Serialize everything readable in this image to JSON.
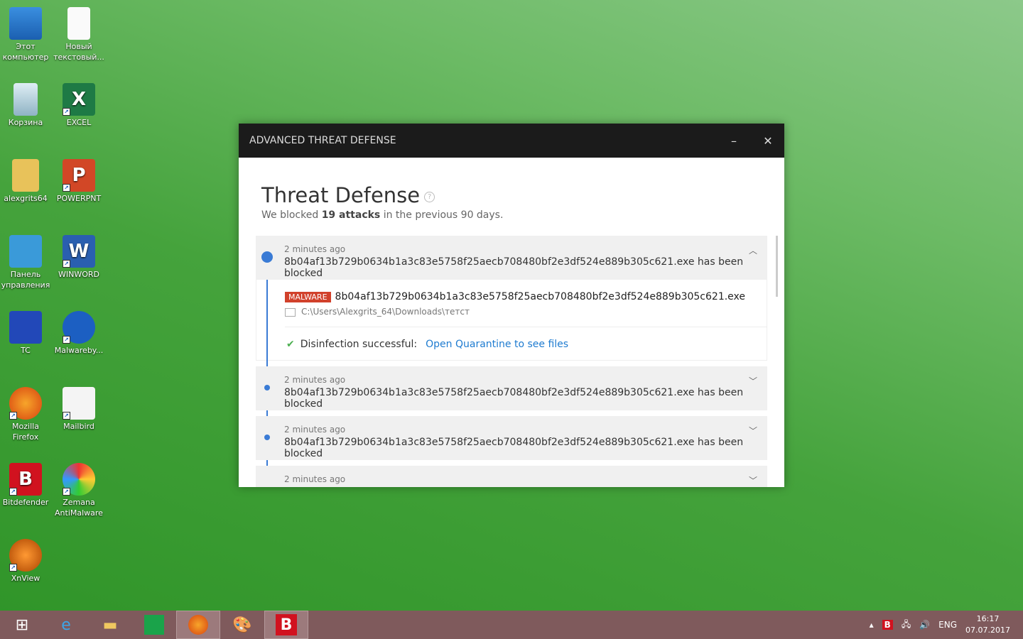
{
  "desktop": {
    "icons": [
      {
        "label": "Этот компьютер",
        "name": "this-pc"
      },
      {
        "label": "Новый текстовый...",
        "name": "new-text-file"
      },
      {
        "label": "Корзина",
        "name": "recycle-bin"
      },
      {
        "label": "EXCEL",
        "name": "excel"
      },
      {
        "label": "alexgrits64",
        "name": "user-folder"
      },
      {
        "label": "POWERPNT",
        "name": "powerpoint"
      },
      {
        "label": "Панель управления",
        "name": "control-panel"
      },
      {
        "label": "WINWORD",
        "name": "word"
      },
      {
        "label": "TC",
        "name": "total-commander"
      },
      {
        "label": "Malwareby...",
        "name": "malwarebytes"
      },
      {
        "label": "Mozilla Firefox",
        "name": "firefox"
      },
      {
        "label": "Mailbird",
        "name": "mailbird"
      },
      {
        "label": "Bitdefender",
        "name": "bitdefender"
      },
      {
        "label": "Zemana AntiMalware",
        "name": "zemana"
      },
      {
        "label": "XnView",
        "name": "xnview"
      }
    ]
  },
  "window": {
    "title": "ADVANCED THREAT DEFENSE",
    "heading": "Threat Defense",
    "sub_pre": "We blocked ",
    "sub_bold": "19 attacks",
    "sub_post": " in the previous 90 days.",
    "items": [
      {
        "time": "2 minutes ago",
        "message": "8b04af13b729b0634b1a3c83e5758f25aecb708480bf2e3df524e889b305c621.exe has been blocked"
      },
      {
        "time": "2 minutes ago",
        "message": "8b04af13b729b0634b1a3c83e5758f25aecb708480bf2e3df524e889b305c621.exe has been blocked"
      },
      {
        "time": "2 minutes ago",
        "message": "8b04af13b729b0634b1a3c83e5758f25aecb708480bf2e3df524e889b305c621.exe has been blocked"
      },
      {
        "time": "2 minutes ago",
        "message": ""
      }
    ],
    "detail": {
      "badge": "MALWARE",
      "file": "8b04af13b729b0634b1a3c83e5758f25aecb708480bf2e3df524e889b305c621.exe",
      "path": "C:\\Users\\Alexgrits_64\\Downloads\\тетст",
      "status": "Disinfection successful:",
      "link": "Open Quarantine to see files"
    }
  },
  "tray": {
    "lang": "ENG",
    "time": "16:17",
    "date": "07.07.2017"
  }
}
